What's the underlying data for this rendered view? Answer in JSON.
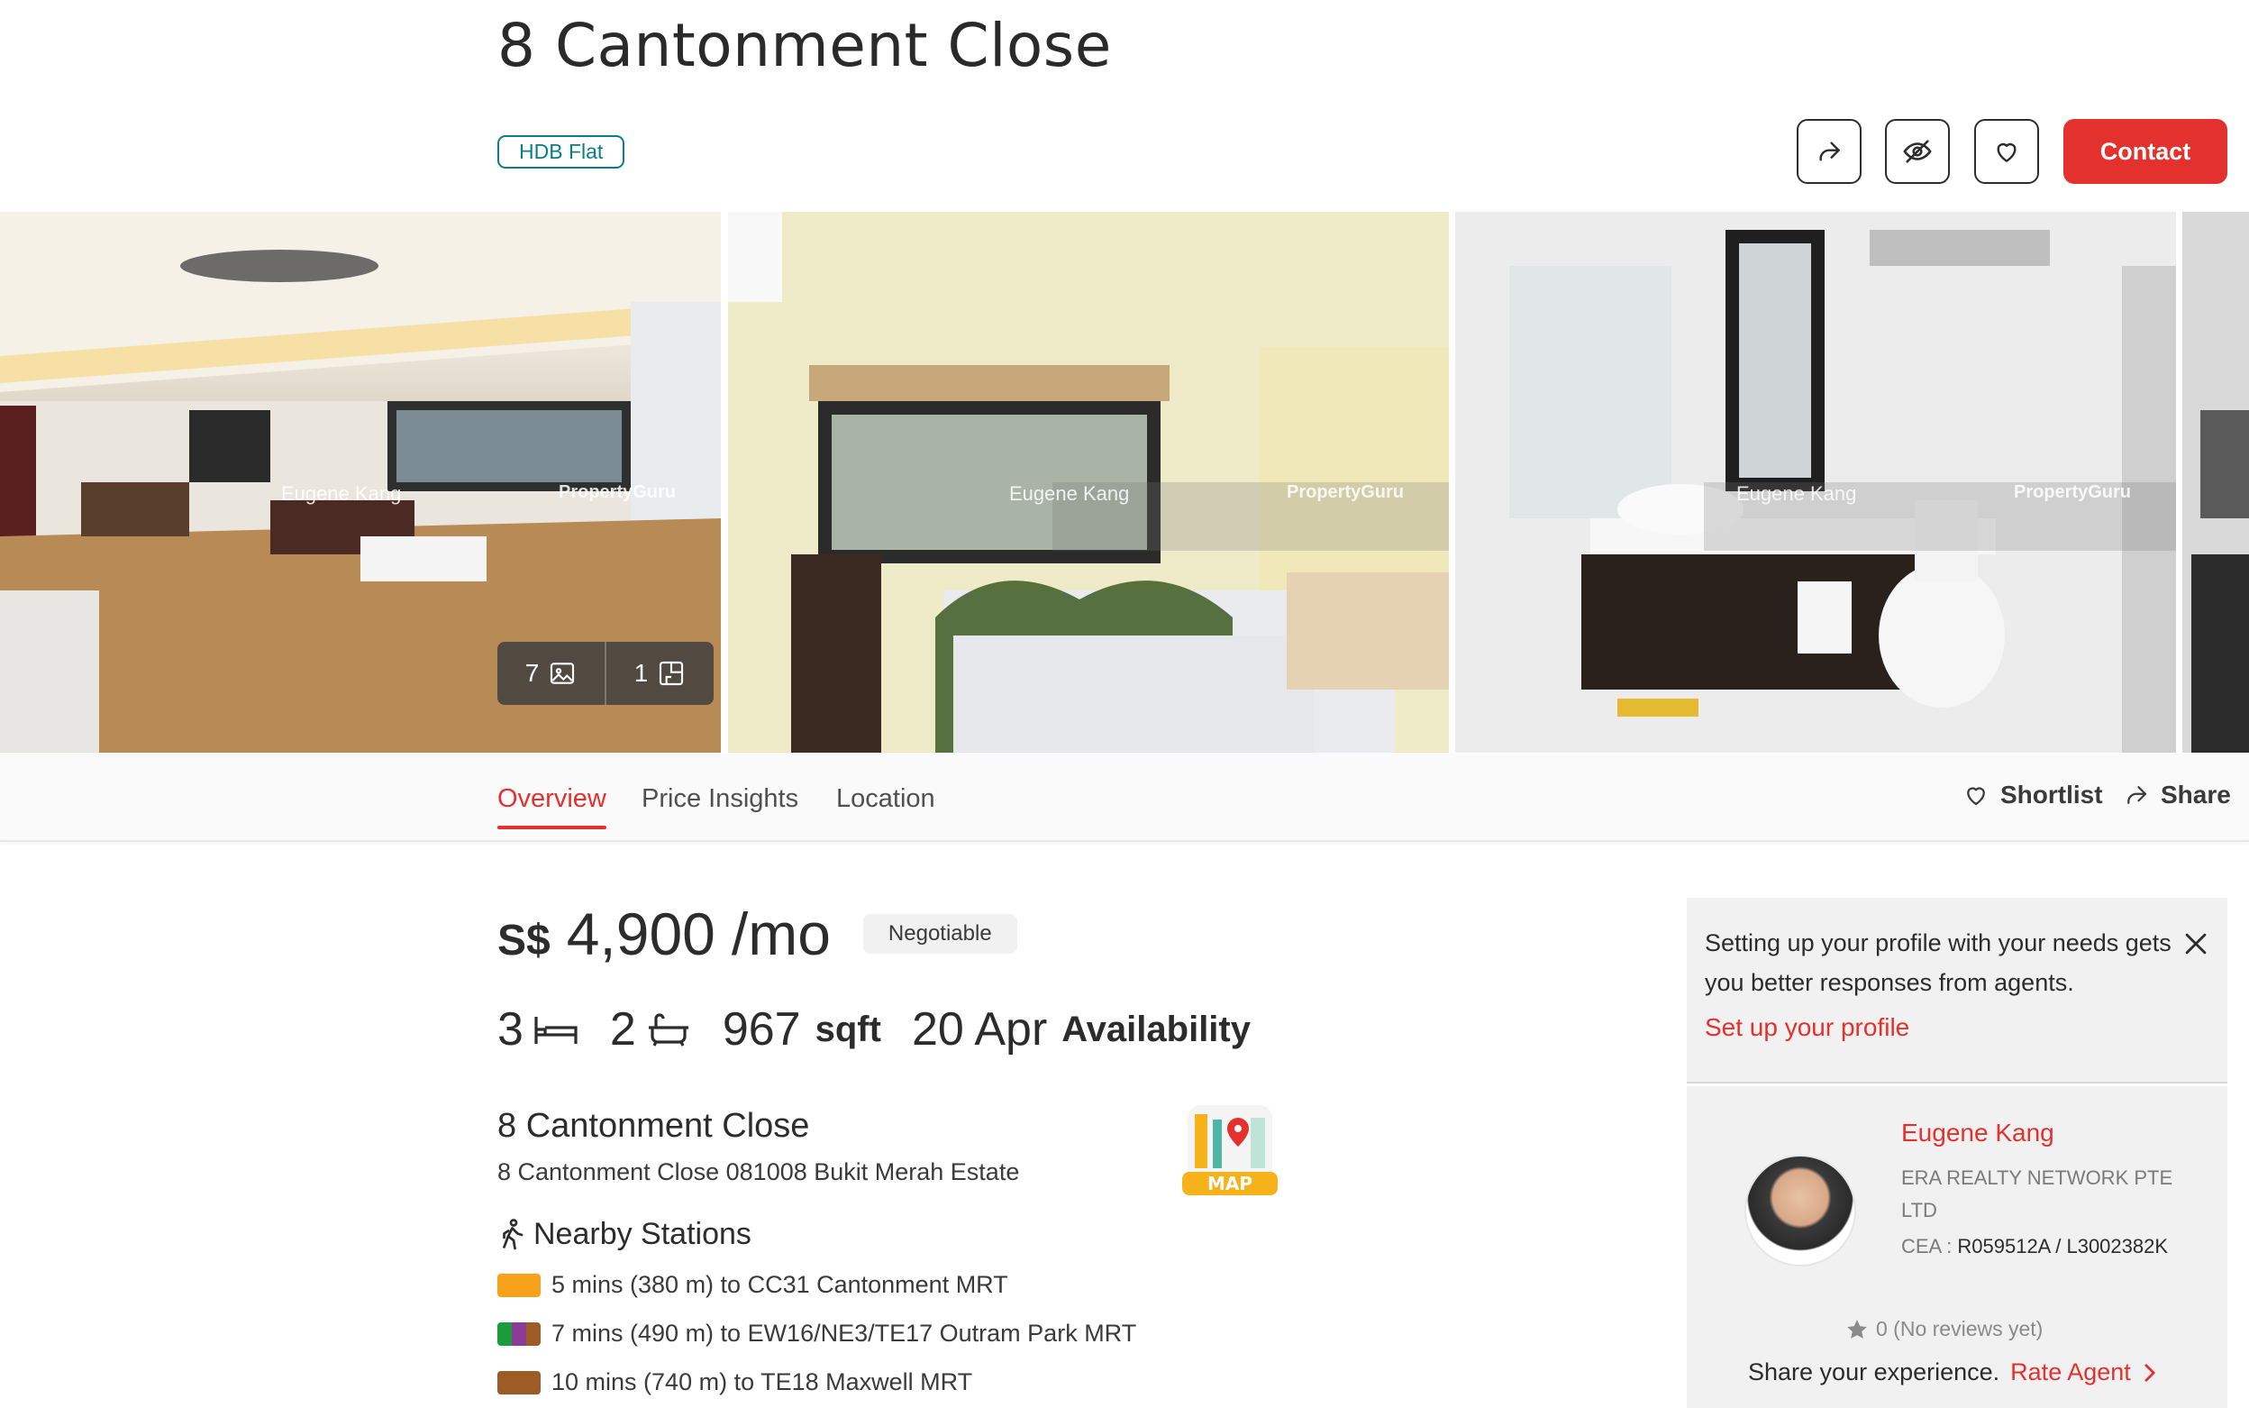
{
  "header": {
    "title": "8 Cantonment Close",
    "tag": "HDB Flat",
    "contact_label": "Contact"
  },
  "gallery": {
    "watermark_agent": "Eugene Kang",
    "watermark_brand": "PropertyGuru",
    "photo_count": "7",
    "floorplan_count": "1"
  },
  "tabs": {
    "overview": "Overview",
    "price_insights": "Price Insights",
    "location": "Location",
    "shortlist": "Shortlist",
    "share": "Share"
  },
  "listing": {
    "currency": "S$",
    "price": "4,900",
    "unit": "/mo",
    "negotiable": "Negotiable",
    "bedrooms": "3",
    "bathrooms": "2",
    "area": "967",
    "area_unit": "sqft",
    "availability_date": "20 Apr",
    "availability_label": "Availability"
  },
  "address": {
    "title": "8 Cantonment Close",
    "full": "8 Cantonment Close 081008 Bukit Merah Estate",
    "map_label": "MAP"
  },
  "nearby": {
    "title": "Nearby Stations",
    "stations": [
      {
        "text": "5 mins (380 m) to CC31 Cantonment MRT",
        "colors": [
          "#f7a21b"
        ]
      },
      {
        "text": "7 mins (490 m) to EW16/NE3/TE17 Outram Park MRT",
        "colors": [
          "#1a9c3c",
          "#8e3a97",
          "#9d5b25"
        ]
      },
      {
        "text": "10 mins (740 m) to TE18 Maxwell MRT",
        "colors": [
          "#9d5b25"
        ]
      }
    ]
  },
  "profile_prompt": {
    "text": "Setting up your profile with your needs gets you better responses from agents.",
    "link": "Set up your profile"
  },
  "agent": {
    "name": "Eugene Kang",
    "company": "ERA REALTY NETWORK PTE LTD",
    "cea_label": "CEA :",
    "cea_value": "R059512A / L3002382K",
    "rating": "0 (No reviews yet)",
    "share_prompt": "Share your experience.",
    "rate_label": "Rate Agent"
  },
  "colors": {
    "accent": "#e3312e",
    "tag": "#0b7f86"
  }
}
